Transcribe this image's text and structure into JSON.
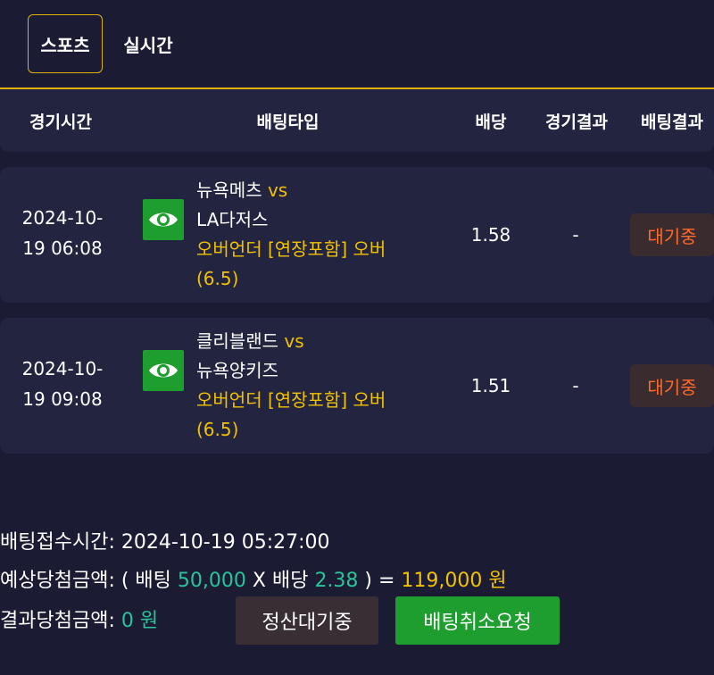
{
  "tabs": {
    "sports": "스포츠",
    "live": "실시간"
  },
  "table_header": {
    "game_time": "경기시간",
    "bet_type": "배팅타입",
    "odds": "배당",
    "game_result": "경기결과",
    "bet_result": "배팅결과"
  },
  "rows": [
    {
      "date": "2024-10-",
      "time": "19 06:08",
      "home": "뉴욕메츠",
      "vs": "vs",
      "away": "LA다저스",
      "market": "오버언더 [연장포함] 오버",
      "line": "(6.5)",
      "odds": "1.58",
      "result": "-",
      "status": "대기중"
    },
    {
      "date": "2024-10-",
      "time": "19 09:08",
      "home": "클리블랜드",
      "vs": "vs",
      "away": "뉴욕양키즈",
      "market": "오버언더 [연장포함] 오버",
      "line": "(6.5)",
      "odds": "1.51",
      "result": "-",
      "status": "대기중"
    }
  ],
  "summary": {
    "receipt_label": "배팅접수시간:",
    "receipt_time": "2024-10-19 05:27:00",
    "expected_label": "예상당첨금액: ( 배팅",
    "bet_amount": "50,000",
    "x_label": "X 배당",
    "total_odds": "2.38",
    "equals": ") =",
    "expected_amount": "119,000 원",
    "result_label": "결과당첨금액:",
    "result_amount": "0 원"
  },
  "buttons": {
    "settle": "정산대기중",
    "cancel": "배팅취소요청"
  },
  "colors": {
    "background": "#1b1c34",
    "card": "#232440",
    "accent_gold": "#f2c200",
    "teal": "#29c49a",
    "status_orange": "#ff6a2a",
    "green": "#1e9e2f"
  }
}
